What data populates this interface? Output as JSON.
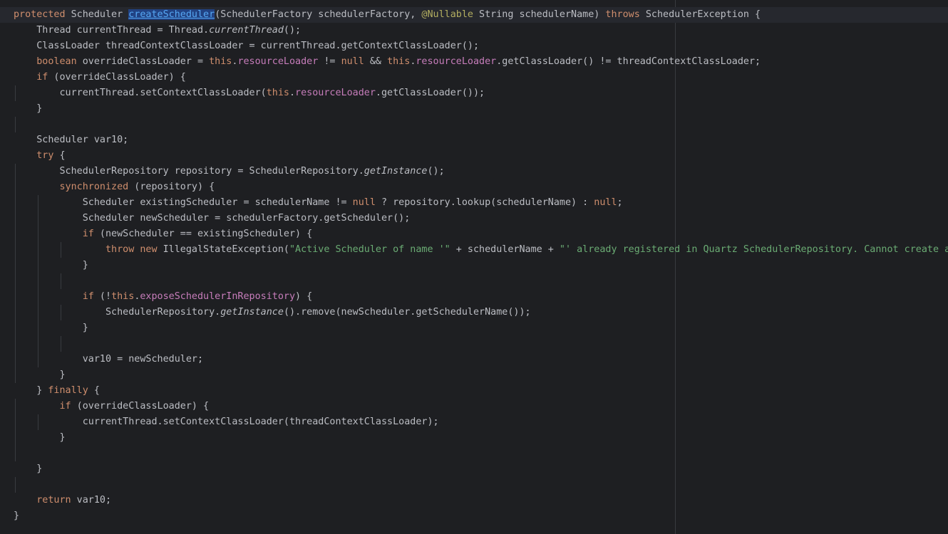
{
  "editor": {
    "language": "java",
    "colors": {
      "background": "#1e1f22",
      "current_line": "#26282e",
      "text": "#bcbec4",
      "keyword": "#cf8e6d",
      "method_declaration": "#56a8f5",
      "annotation": "#b3ae60",
      "field": "#c77dbb",
      "string": "#6aab73",
      "guide": "#393b40"
    },
    "lines": [
      {
        "indent": 0,
        "current": true,
        "tokens": [
          {
            "t": "protected",
            "c": "kw"
          },
          {
            "t": " Scheduler "
          },
          {
            "t": "createScheduler",
            "c": "fn sel under"
          },
          {
            "t": "(SchedulerFactory schedulerFactory, "
          },
          {
            "t": "@Nullable",
            "c": "ann"
          },
          {
            "t": " String schedulerName) "
          },
          {
            "t": "throws",
            "c": "kw"
          },
          {
            "t": " SchedulerException {"
          }
        ]
      },
      {
        "indent": 1,
        "tokens": [
          {
            "t": "Thread currentThread = Thread."
          },
          {
            "t": "currentThread",
            "c": "ital"
          },
          {
            "t": "();"
          }
        ]
      },
      {
        "indent": 1,
        "tokens": [
          {
            "t": "ClassLoader threadContextClassLoader = currentThread.getContextClassLoader();"
          }
        ]
      },
      {
        "indent": 1,
        "tokens": [
          {
            "t": "boolean",
            "c": "kw"
          },
          {
            "t": " overrideClassLoader = "
          },
          {
            "t": "this",
            "c": "kw"
          },
          {
            "t": "."
          },
          {
            "t": "resourceLoader",
            "c": "fld"
          },
          {
            "t": " != "
          },
          {
            "t": "null",
            "c": "kw"
          },
          {
            "t": " && "
          },
          {
            "t": "this",
            "c": "kw"
          },
          {
            "t": "."
          },
          {
            "t": "resourceLoader",
            "c": "fld"
          },
          {
            "t": ".getClassLoader() != threadContextClassLoader;"
          }
        ]
      },
      {
        "indent": 1,
        "tokens": [
          {
            "t": "if",
            "c": "kw"
          },
          {
            "t": " (overrideClassLoader) {"
          }
        ]
      },
      {
        "indent": 2,
        "tokens": [
          {
            "t": "currentThread.setContextClassLoader("
          },
          {
            "t": "this",
            "c": "kw"
          },
          {
            "t": "."
          },
          {
            "t": "resourceLoader",
            "c": "fld"
          },
          {
            "t": ".getClassLoader());"
          }
        ]
      },
      {
        "indent": 1,
        "tokens": [
          {
            "t": "}"
          }
        ]
      },
      {
        "indent": 0,
        "tokens": []
      },
      {
        "indent": 1,
        "tokens": [
          {
            "t": "Scheduler var10;"
          }
        ]
      },
      {
        "indent": 1,
        "tokens": [
          {
            "t": "try",
            "c": "kw"
          },
          {
            "t": " {"
          }
        ]
      },
      {
        "indent": 2,
        "tokens": [
          {
            "t": "SchedulerRepository repository = SchedulerRepository."
          },
          {
            "t": "getInstance",
            "c": "ital"
          },
          {
            "t": "();"
          }
        ]
      },
      {
        "indent": 2,
        "tokens": [
          {
            "t": "synchronized",
            "c": "kw"
          },
          {
            "t": " (repository) {"
          }
        ]
      },
      {
        "indent": 3,
        "tokens": [
          {
            "t": "Scheduler existingScheduler = schedulerName != "
          },
          {
            "t": "null",
            "c": "kw"
          },
          {
            "t": " ? repository.lookup(schedulerName) : "
          },
          {
            "t": "null",
            "c": "kw"
          },
          {
            "t": ";"
          }
        ]
      },
      {
        "indent": 3,
        "tokens": [
          {
            "t": "Scheduler newScheduler = schedulerFactory.getScheduler();"
          }
        ]
      },
      {
        "indent": 3,
        "tokens": [
          {
            "t": "if",
            "c": "kw"
          },
          {
            "t": " (newScheduler == existingScheduler) {"
          }
        ]
      },
      {
        "indent": 4,
        "tokens": [
          {
            "t": "throw",
            "c": "kw"
          },
          {
            "t": " "
          },
          {
            "t": "new",
            "c": "kw"
          },
          {
            "t": " IllegalStateException("
          },
          {
            "t": "\"Active Scheduler of name '\"",
            "c": "str"
          },
          {
            "t": " + schedulerName + "
          },
          {
            "t": "\"' already registered in Quartz SchedulerRepository. Cannot create a",
            "c": "str"
          }
        ]
      },
      {
        "indent": 3,
        "tokens": [
          {
            "t": "}"
          }
        ]
      },
      {
        "indent": 0,
        "tokens": []
      },
      {
        "indent": 3,
        "tokens": [
          {
            "t": "if",
            "c": "kw"
          },
          {
            "t": " (!"
          },
          {
            "t": "this",
            "c": "kw"
          },
          {
            "t": "."
          },
          {
            "t": "exposeSchedulerInRepository",
            "c": "fld"
          },
          {
            "t": ") {"
          }
        ]
      },
      {
        "indent": 4,
        "tokens": [
          {
            "t": "SchedulerRepository."
          },
          {
            "t": "getInstance",
            "c": "ital"
          },
          {
            "t": "().remove(newScheduler.getSchedulerName());"
          }
        ]
      },
      {
        "indent": 3,
        "tokens": [
          {
            "t": "}"
          }
        ]
      },
      {
        "indent": 0,
        "tokens": []
      },
      {
        "indent": 3,
        "tokens": [
          {
            "t": "var10 = newScheduler;"
          }
        ]
      },
      {
        "indent": 2,
        "tokens": [
          {
            "t": "}"
          }
        ]
      },
      {
        "indent": 1,
        "tokens": [
          {
            "t": "} "
          },
          {
            "t": "finally",
            "c": "kw"
          },
          {
            "t": " {"
          }
        ]
      },
      {
        "indent": 2,
        "tokens": [
          {
            "t": "if",
            "c": "kw"
          },
          {
            "t": " (overrideClassLoader) {"
          }
        ]
      },
      {
        "indent": 3,
        "tokens": [
          {
            "t": "currentThread.setContextClassLoader(threadContextClassLoader);"
          }
        ]
      },
      {
        "indent": 2,
        "tokens": [
          {
            "t": "}"
          }
        ]
      },
      {
        "indent": 0,
        "tokens": []
      },
      {
        "indent": 1,
        "tokens": [
          {
            "t": "}"
          }
        ]
      },
      {
        "indent": 0,
        "tokens": []
      },
      {
        "indent": 1,
        "tokens": [
          {
            "t": "return",
            "c": "kw"
          },
          {
            "t": " var10;"
          }
        ]
      },
      {
        "indent": 0,
        "tokens": [
          {
            "t": "}"
          }
        ]
      }
    ]
  }
}
